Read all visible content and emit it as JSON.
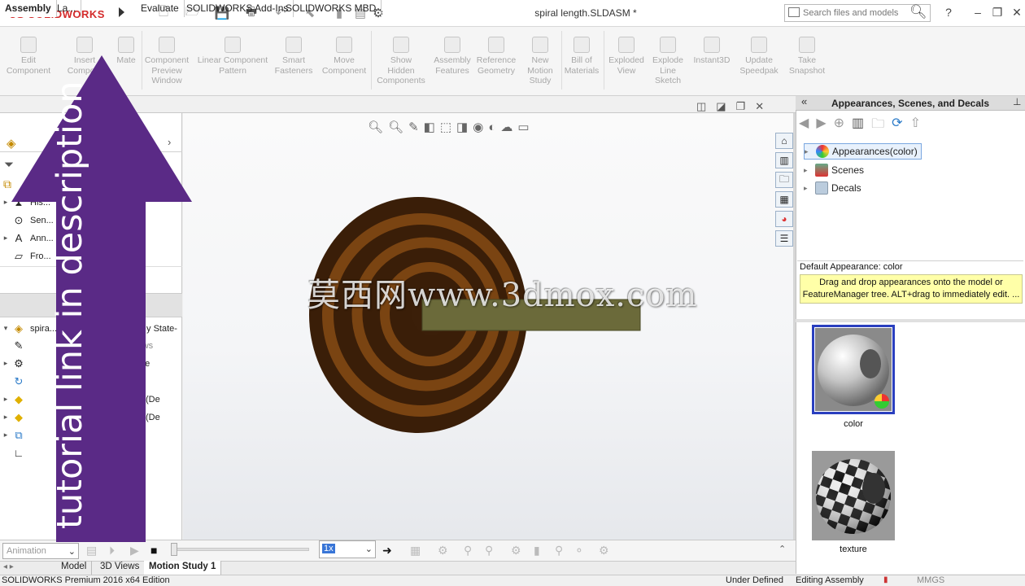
{
  "app": {
    "brand": "SOLIDWORKS",
    "document_title": "spiral length.SLDASM *"
  },
  "search": {
    "placeholder": "Search files and models"
  },
  "ribbon": {
    "buttons": [
      {
        "label": "Edit\nComponent",
        "icon": "edit-component-icon"
      },
      {
        "label": "Insert\nCompo...",
        "icon": "insert-components-icon"
      },
      {
        "label": "Mate",
        "icon": "mate-icon"
      },
      {
        "label": "Component\nPreview\nWindow",
        "icon": "component-preview-icon"
      },
      {
        "label": "Linear Component\nPattern",
        "icon": "linear-pattern-icon"
      },
      {
        "label": "Smart\nFasteners",
        "icon": "smart-fasteners-icon"
      },
      {
        "label": "Move\nComponent",
        "icon": "move-component-icon"
      },
      {
        "label": "Show\nHidden\nComponents",
        "icon": "show-hidden-icon"
      },
      {
        "label": "Assembly\nFeatures",
        "icon": "assembly-features-icon"
      },
      {
        "label": "Reference\nGeometry",
        "icon": "reference-geometry-icon"
      },
      {
        "label": "New\nMotion\nStudy",
        "icon": "new-motion-study-icon"
      },
      {
        "label": "Bill of\nMaterials",
        "icon": "bill-of-materials-icon"
      },
      {
        "label": "Exploded\nView",
        "icon": "exploded-view-icon"
      },
      {
        "label": "Explode\nLine\nSketch",
        "icon": "explode-line-sketch-icon"
      },
      {
        "label": "Instant3D",
        "icon": "instant3d-icon"
      },
      {
        "label": "Update\nSpeedpak",
        "icon": "update-speedpak-icon"
      },
      {
        "label": "Take\nSnapshot",
        "icon": "take-snapshot-icon"
      }
    ]
  },
  "command_tabs": [
    "Assembly",
    "La...",
    "Evaluate",
    "SOLIDWORKS Add-Ins",
    "SOLIDWORKS MBD"
  ],
  "feature_tree": {
    "top_items": [
      "His...",
      "Sen...",
      "Ann...",
      "Fro..."
    ],
    "root": "spira...",
    "root_suffix": "y State-",
    "rows": [
      "Views",
      "me",
      "<1> (De",
      "<1> (De"
    ]
  },
  "overlay": {
    "text": "tutorial link in description",
    "color": "#5a2a86"
  },
  "watermark": "莫西网www.3dmox.com",
  "model_colors": {
    "outer": "#3a1e08",
    "ring_light": "#7a4412",
    "ring_dark": "#3b1f09",
    "bar": "#6b6a3a"
  },
  "task_pane": {
    "title": "Appearances, Scenes, and Decals",
    "items": [
      {
        "label": "Appearances(color)",
        "icon": "appearances-icon"
      },
      {
        "label": "Scenes",
        "icon": "scenes-icon"
      },
      {
        "label": "Decals",
        "icon": "decals-icon"
      }
    ],
    "default_label": "Default Appearance: color",
    "info": "Drag and drop appearances onto the model or FeatureManager tree.  ALT+drag to immediately edit. ...",
    "thumbnails": [
      "color",
      "texture"
    ]
  },
  "motion": {
    "type": "Animation",
    "speed": "1x"
  },
  "bottom_tabs": [
    "Model",
    "3D Views",
    "Motion Study 1"
  ],
  "status": {
    "edition": "SOLIDWORKS Premium 2016 x64 Edition",
    "definition": "Under Defined",
    "mode": "Editing Assembly",
    "units": "MMGS"
  }
}
